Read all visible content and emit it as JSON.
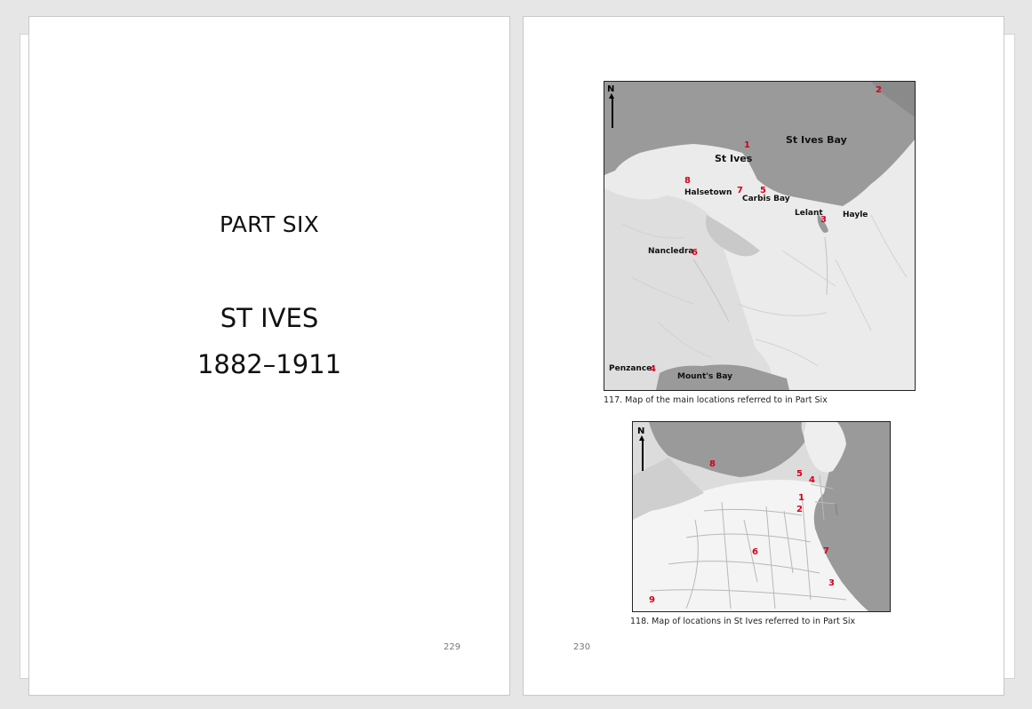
{
  "left_page": {
    "part_title": "PART SIX",
    "chapter_title": "ST IVES",
    "chapter_dates": "1882–1911",
    "page_number": "229"
  },
  "right_page": {
    "page_number": "230",
    "map1": {
      "north": "N",
      "place_labels": [
        "St Ives Bay",
        "St Ives",
        "Halsetown",
        "Carbis Bay",
        "Lelant",
        "Hayle",
        "Nancledra",
        "Penzance",
        "Mount's Bay"
      ],
      "markers": [
        "1",
        "2",
        "3",
        "4",
        "5",
        "6",
        "7",
        "8"
      ],
      "caption": "117. Map of the main locations referred to in Part Six"
    },
    "map2": {
      "north": "N",
      "markers": [
        "1",
        "2",
        "3",
        "4",
        "5",
        "6",
        "7",
        "8",
        "9"
      ],
      "caption": "118. Map of locations in St Ives referred to in Part Six"
    }
  },
  "colors": {
    "sea": "#9a9a9a",
    "land": "#ebebeb",
    "marker": "#d4001a",
    "background": "#e6e6e6"
  }
}
